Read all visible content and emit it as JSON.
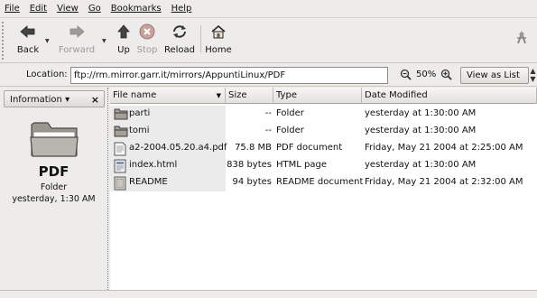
{
  "menu": [
    "File",
    "Edit",
    "View",
    "Go",
    "Bookmarks",
    "Help"
  ],
  "toolbar": {
    "back": "Back",
    "forward": "Forward",
    "up": "Up",
    "stop": "Stop",
    "reload": "Reload",
    "home": "Home"
  },
  "location": {
    "label": "Location:",
    "value": "ftp://rm.mirror.garr.it/mirrors/AppuntiLinux/PDF",
    "zoom": "50%",
    "view_as": "View as List"
  },
  "sidebar": {
    "selector": "Information",
    "name": "PDF",
    "type": "Folder",
    "date": "yesterday, 1:30 AM"
  },
  "columns": {
    "name": "File name",
    "size": "Size",
    "type": "Type",
    "date": "Date Modified"
  },
  "files": [
    {
      "name": "parti",
      "size": "--",
      "type": "Folder",
      "date": "yesterday at 1:30:00 AM",
      "icon": "folder-icon"
    },
    {
      "name": "tomi",
      "size": "--",
      "type": "Folder",
      "date": "yesterday at 1:30:00 AM",
      "icon": "folder-icon"
    },
    {
      "name": "a2-2004.05.20.a4.pdf",
      "size": "75.8 MB",
      "type": "PDF document",
      "date": "Friday, May 21 2004 at 2:25:00 AM",
      "icon": "pdf-document-icon"
    },
    {
      "name": "index.html",
      "size": "838 bytes",
      "type": "HTML page",
      "date": "yesterday at 1:30:00 AM",
      "icon": "html-page-icon"
    },
    {
      "name": "README",
      "size": "94 bytes",
      "type": "README document",
      "date": "Friday, May 21 2004 at 2:32:00 AM",
      "icon": "readme-document-icon"
    }
  ]
}
